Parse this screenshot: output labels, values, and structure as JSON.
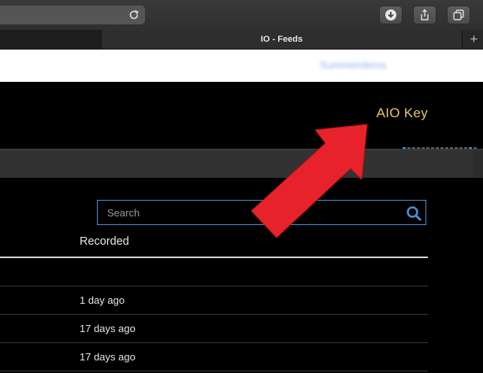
{
  "browser": {
    "tab_title": "IO - Feeds",
    "new_tab_symbol": "+",
    "toolbar_icons": [
      "reload-icon",
      "download-icon",
      "share-icon",
      "tabs-overview-icon"
    ]
  },
  "top_strip": {
    "blurred_link_text": "Summenderos"
  },
  "header": {
    "aio_key_label": "AIO Key"
  },
  "search": {
    "placeholder": "Search",
    "value": ""
  },
  "table": {
    "column_header": "Recorded",
    "rows": [
      {
        "recorded": ""
      },
      {
        "recorded": "1 day ago"
      },
      {
        "recorded": "17 days ago"
      },
      {
        "recorded": "17 days ago"
      }
    ]
  },
  "colors": {
    "accent_gold": "#e8c46f",
    "search_border": "#4a8fd0",
    "arrow_red": "#e8222b"
  }
}
